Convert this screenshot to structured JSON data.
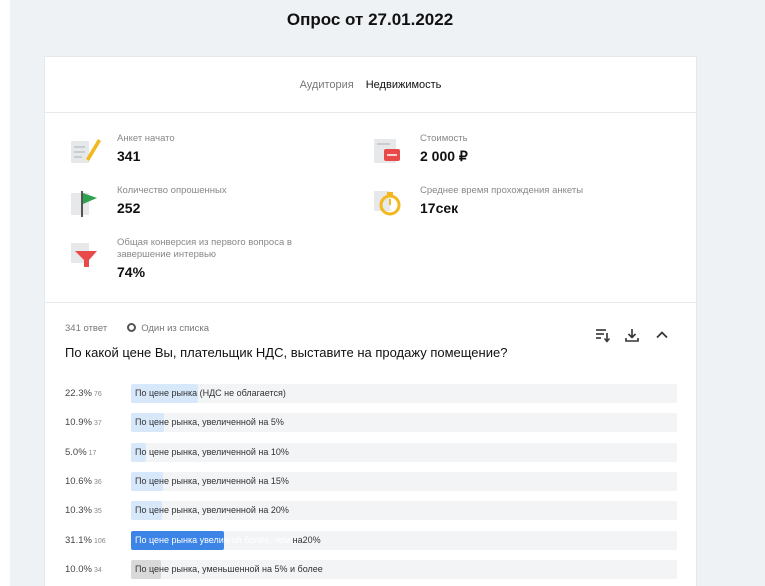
{
  "page": {
    "title": "Опрос от 27.01.2022"
  },
  "tabs": [
    {
      "label": "Аудитория",
      "active": false
    },
    {
      "label": "Недвижимость",
      "active": true
    }
  ],
  "stats": {
    "started": {
      "label": "Анкет начато",
      "value": "341",
      "icon": "document-pencil-icon"
    },
    "cost": {
      "label": "Стоимость",
      "value": "2 000 ₽",
      "icon": "wallet-icon"
    },
    "surveyed": {
      "label": "Количество опрошенных",
      "value": "252",
      "icon": "flag-icon"
    },
    "avg_time": {
      "label": "Среднее время прохождения анкеты",
      "value": "17сек",
      "icon": "stopwatch-icon"
    },
    "conversion": {
      "label": "Общая конверсия из первого вопроса в завершение интервью",
      "value": "74%",
      "icon": "funnel-icon"
    }
  },
  "question": {
    "answers_count": "341 ответ",
    "type": "Один из списка",
    "text": "По какой цене Вы, плательщик НДС, выставите на продажу помещение?",
    "tools": [
      "sort-icon",
      "download-icon",
      "collapse-chevron-icon"
    ],
    "options": [
      {
        "pct": "22.3%",
        "count": "76",
        "label": "По цене рынка (НДС не облагается)",
        "share": 22.3
      },
      {
        "pct": "10.9%",
        "count": "37",
        "label": "По цене рынка, увеличенной на 5%",
        "share": 10.9
      },
      {
        "pct": "5.0%",
        "count": "17",
        "label": "По цене рынка, увеличенной на 10%",
        "share": 5.0
      },
      {
        "pct": "10.6%",
        "count": "36",
        "label": "По цене рынка, увеличенной на 15%",
        "share": 10.6
      },
      {
        "pct": "10.3%",
        "count": "35",
        "label": "По цене рынка, увеличенной на 20%",
        "share": 10.3
      },
      {
        "pct": "31.1%",
        "count": "106",
        "label_in": "По цене рынка увелич-ой более, чем ",
        "label_out": "на20%",
        "share": 31.1,
        "highlight": true
      },
      {
        "pct": "10.0%",
        "count": "34",
        "label": "По цене рынка, уменьшенной на 5% и более",
        "share": 10.0,
        "grey": true
      }
    ]
  },
  "colors": {
    "highlight": "#3c84e6",
    "bar": "#d7e8fb",
    "accent_red": "#e84a4a",
    "accent_green": "#2fa24f",
    "accent_yellow": "#f2b81d"
  }
}
